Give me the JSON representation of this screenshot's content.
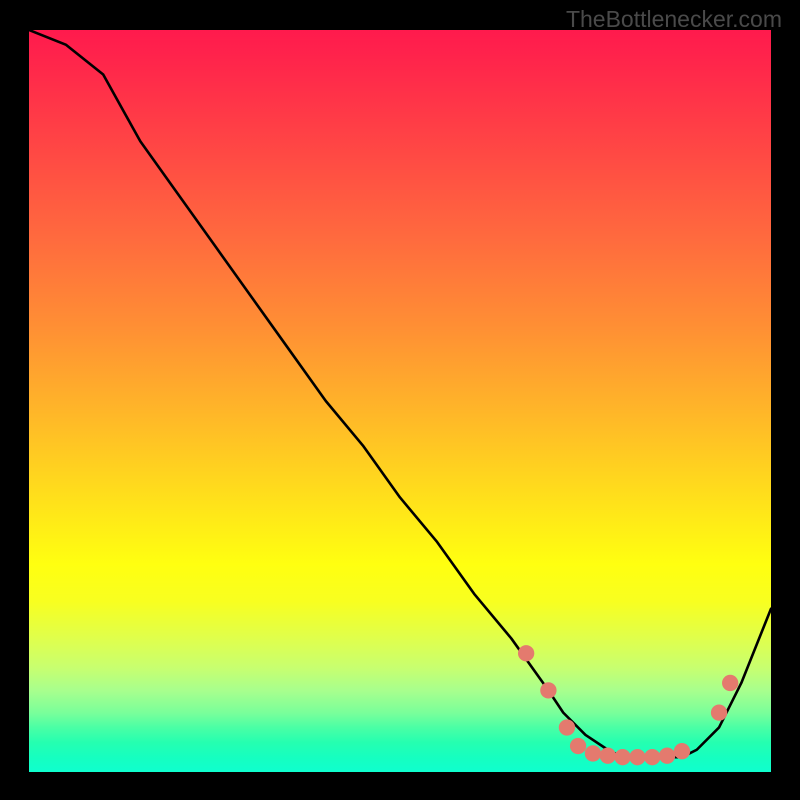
{
  "watermark": "TheBottlenecker.com",
  "chart_data": {
    "type": "line",
    "title": "",
    "xlabel": "",
    "ylabel": "",
    "xlim": [
      0,
      100
    ],
    "ylim": [
      0,
      100
    ],
    "series": [
      {
        "name": "curve",
        "color": "#000000",
        "x": [
          0,
          5,
          10,
          15,
          20,
          25,
          30,
          35,
          40,
          45,
          50,
          55,
          60,
          65,
          70,
          72,
          75,
          78,
          80,
          82,
          85,
          88,
          90,
          93,
          96,
          100
        ],
        "y": [
          100,
          98,
          94,
          85,
          78,
          71,
          64,
          57,
          50,
          44,
          37,
          31,
          24,
          18,
          11,
          8,
          5,
          3,
          2,
          2,
          2,
          2,
          3,
          6,
          12,
          22
        ]
      }
    ],
    "markers": {
      "name": "dots",
      "color": "#e47a6e",
      "radius_pct": 1.1,
      "points": [
        {
          "x": 67,
          "y": 16
        },
        {
          "x": 70,
          "y": 11
        },
        {
          "x": 72.5,
          "y": 6
        },
        {
          "x": 74,
          "y": 3.5
        },
        {
          "x": 76,
          "y": 2.5
        },
        {
          "x": 78,
          "y": 2.2
        },
        {
          "x": 80,
          "y": 2.0
        },
        {
          "x": 82,
          "y": 2.0
        },
        {
          "x": 84,
          "y": 2.0
        },
        {
          "x": 86,
          "y": 2.2
        },
        {
          "x": 88,
          "y": 2.8
        },
        {
          "x": 93,
          "y": 8
        },
        {
          "x": 94.5,
          "y": 12
        }
      ]
    }
  }
}
